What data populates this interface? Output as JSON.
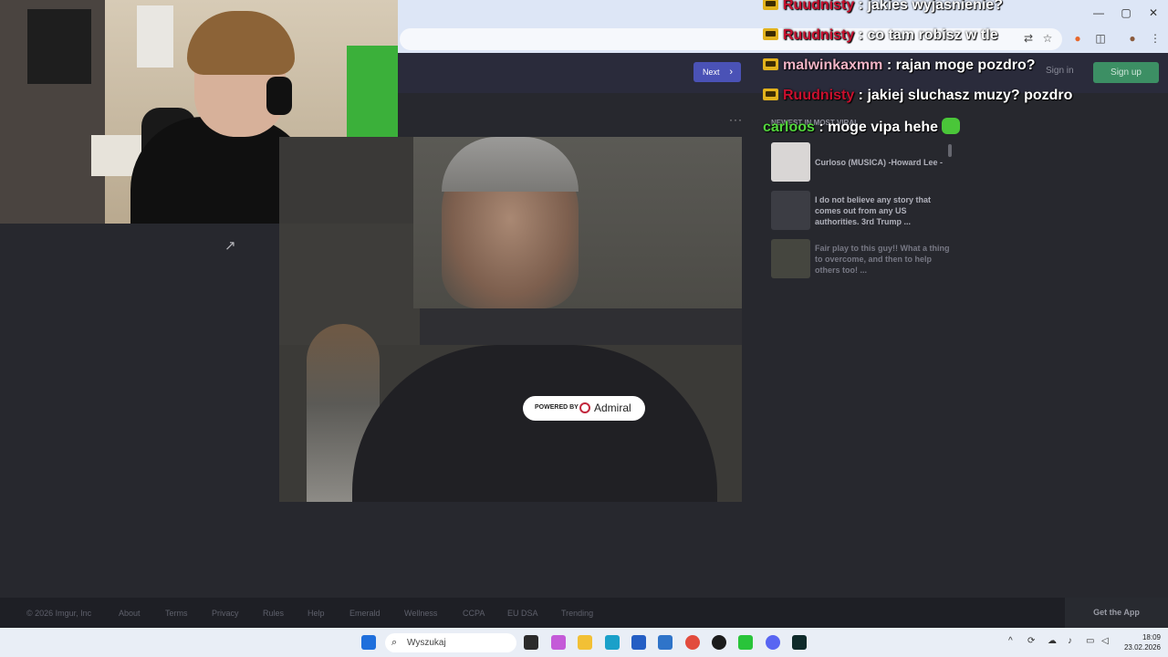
{
  "browser": {
    "window_controls": [
      "—",
      "▢",
      "✕"
    ],
    "toolbar_icons": [
      "translate-icon",
      "star-icon",
      "extension-icon",
      "puzzle-icon",
      "profile-avatar",
      "menu-icon"
    ]
  },
  "site": {
    "next_label": "Next",
    "sign_in_label": "Sign in",
    "sign_up_label": "Sign up",
    "more_glyph": "···",
    "share_glyph": "↗"
  },
  "ad": {
    "powered_by": "POWERED BY",
    "brand": "Admiral"
  },
  "sidebar": {
    "heading": "NEWEST IN MOST VIRAL",
    "items": [
      {
        "title": "Curloso (MUSICA) -Howard Lee -"
      },
      {
        "title": "I do not believe any story that comes out from any US authorities. 3rd Trump ..."
      },
      {
        "title": "Fair play to this guy!! What a thing to overcome, and then to help others too! ..."
      }
    ]
  },
  "chat": {
    "messages": [
      {
        "user": "Ruudnisty",
        "text": ": jakies wyjasnienie?",
        "color": "#c8102e",
        "badge": true
      },
      {
        "user": "Ruudnisty",
        "text": ": co tam robisz w tle",
        "color": "#c8102e",
        "badge": true
      },
      {
        "user": "malwinkaxmm",
        "text": ": rajan moge pozdro?",
        "color": "#f1b3c5",
        "badge": true
      },
      {
        "user": "Ruudnisty",
        "text": ": jakiej sluchasz muzy? pozdro",
        "color": "#c8102e",
        "badge": true
      },
      {
        "user": "carloos",
        "text": ": moge vipa hehe",
        "color": "#53d63d",
        "badge": false
      }
    ]
  },
  "footer": {
    "links": [
      "© 2026 Imgur, Inc",
      "About",
      "Terms",
      "Privacy",
      "Rules",
      "Help",
      "Emerald",
      "Wellness",
      "CCPA",
      "EU DSA",
      "Trending"
    ],
    "get_app": "Get the App"
  },
  "taskbar": {
    "search_placeholder": "Wyszukaj",
    "time": "18:09",
    "date": "23.02.2026"
  },
  "colors": {
    "accent": "#4a52b6",
    "signup": "#3c8f64",
    "page_bg": "#27282e"
  }
}
